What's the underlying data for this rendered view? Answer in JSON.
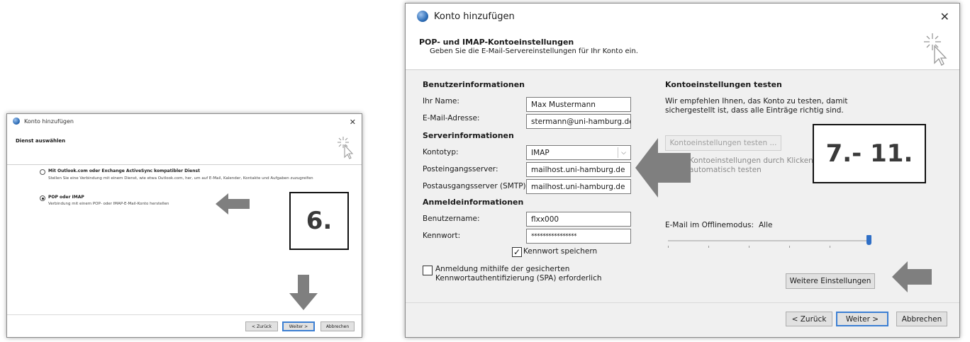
{
  "dialog1": {
    "title": "Konto hinzufügen",
    "header": "Dienst auswählen",
    "option1": {
      "title": "Mit Outlook.com oder Exchange ActiveSync kompatibler Dienst",
      "desc": "Stellen Sie eine Verbindung mit einem Dienst, wie etwa Outlook.com, her, um auf E-Mail, Kalender, Kontakte und Aufgaben zuzugreifen"
    },
    "option2": {
      "title": "POP oder IMAP",
      "desc": "Verbindung mit einem POP- oder IMAP-E-Mail-Konto herstellen"
    },
    "buttons": {
      "back": "< Zurück",
      "next": "Weiter >",
      "cancel": "Abbrechen"
    },
    "callout": "6."
  },
  "dialog2": {
    "title": "Konto hinzufügen",
    "header_title": "POP- und IMAP-Kontoeinstellungen",
    "header_subtitle": "Geben Sie die E-Mail-Servereinstellungen für Ihr Konto ein.",
    "user_section": "Benutzerinformationen",
    "name_label": "Ihr Name:",
    "name_value": "Max Mustermann",
    "email_label": "E-Mail-Adresse:",
    "email_value": "stermann@uni-hamburg.de",
    "server_section": "Serverinformationen",
    "type_label": "Kontotyp:",
    "type_value": "IMAP",
    "incoming_label": "Posteingangsserver:",
    "incoming_value": "mailhost.uni-hamburg.de",
    "outgoing_label": "Postausgangsserver (SMTP):",
    "outgoing_value": "mailhost.uni-hamburg.de",
    "login_section": "Anmeldeinformationen",
    "username_label": "Benutzername:",
    "username_value": "flxx000",
    "password_label": "Kennwort:",
    "password_value": "****************",
    "remember_password": "Kennwort speichern",
    "spa_label_line1": "Anmeldung mithilfe der gesicherten",
    "spa_label_line2": "Kennwortauthentifizierung (SPA) erforderlich",
    "test_section": "Kontoeinstellungen testen",
    "test_desc_line1": "Wir empfehlen Ihnen, das Konto zu testen, damit",
    "test_desc_line2": "sichergestellt ist, dass alle Einträge richtig sind.",
    "test_button": "Kontoeinstellungen testen ...",
    "auto_test_line1": "Kontoeinstellungen durch Klicken",
    "auto_test_line2": "automatisch testen",
    "offline_label": "E-Mail im Offlinemodus:",
    "offline_value": "Alle",
    "more_settings": "Weitere Einstellungen",
    "buttons": {
      "back": "< Zurück",
      "next": "Weiter >",
      "cancel": "Abbrechen"
    },
    "callout": "7.- 11."
  },
  "colors": {
    "arrow": "#7f7f7f",
    "accent": "#3c7fd3",
    "slider": "#2f6fc6"
  }
}
